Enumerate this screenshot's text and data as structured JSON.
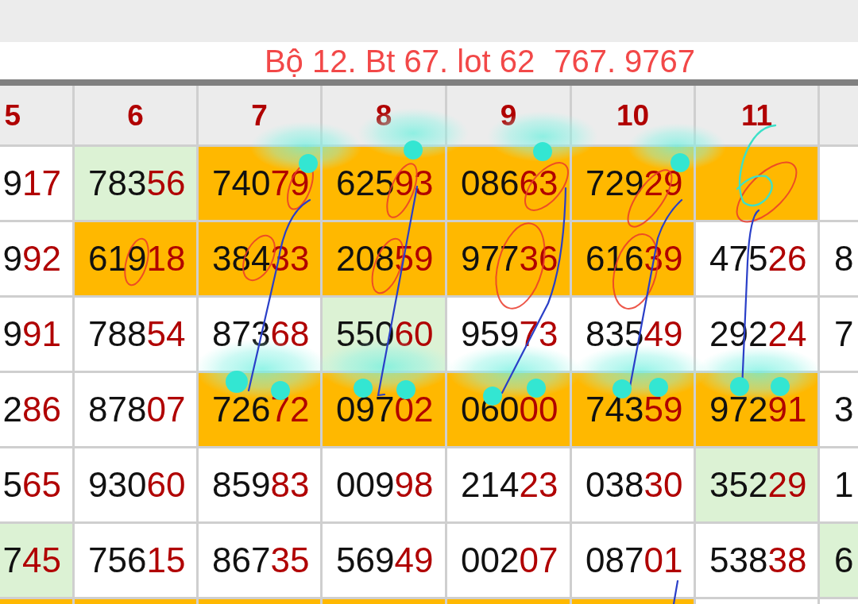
{
  "table": {
    "columns": [
      "5",
      "6",
      "7",
      "8",
      "9",
      "10",
      "11"
    ],
    "rows": [
      {
        "cells": [
          {
            "head": "9",
            "tail": "17",
            "color": "#ffffff"
          },
          {
            "head": "783",
            "tail": "56",
            "color": "#dcf2d4"
          },
          {
            "head": "740",
            "tail": "79",
            "color": "#ffb800"
          },
          {
            "head": "625",
            "tail": "93",
            "color": "#ffb800"
          },
          {
            "head": "086",
            "tail": "63",
            "color": "#ffb800"
          },
          {
            "head": "729",
            "tail": "29",
            "color": "#ffb800"
          },
          {
            "color": "#ffb800"
          },
          {
            "color": "#ffffff"
          }
        ]
      },
      {
        "cells": [
          {
            "head": "9",
            "tail": "92",
            "color": "#ffffff"
          },
          {
            "head": "619",
            "tail": "18",
            "color": "#ffb800"
          },
          {
            "head": "384",
            "tail": "33",
            "color": "#ffb800"
          },
          {
            "head": "208",
            "tail": "59",
            "color": "#ffb800"
          },
          {
            "head": "977",
            "tail": "36",
            "color": "#ffb800"
          },
          {
            "head": "616",
            "tail": "39",
            "color": "#ffb800"
          },
          {
            "head": "475",
            "tail": "26",
            "color": "#ffffff"
          },
          {
            "head": "8",
            "color": "#ffffff"
          }
        ]
      },
      {
        "cells": [
          {
            "head": "9",
            "tail": "91",
            "color": "#ffffff"
          },
          {
            "head": "788",
            "tail": "54",
            "color": "#ffffff"
          },
          {
            "head": "873",
            "tail": "68",
            "color": "#ffffff"
          },
          {
            "head": "550",
            "tail": "60",
            "color": "#dcf2d4"
          },
          {
            "head": "959",
            "tail": "73",
            "color": "#ffffff"
          },
          {
            "head": "835",
            "tail": "49",
            "color": "#ffffff"
          },
          {
            "head": "292",
            "tail": "24",
            "color": "#ffffff"
          },
          {
            "head": "7",
            "color": "#ffffff"
          }
        ]
      },
      {
        "cells": [
          {
            "head": "2",
            "tail": "86",
            "color": "#ffffff"
          },
          {
            "head": "878",
            "tail": "07",
            "color": "#ffffff"
          },
          {
            "head": "726",
            "tail": "72",
            "color": "#ffb800"
          },
          {
            "head": "097",
            "tail": "02",
            "color": "#ffb800"
          },
          {
            "head": "060",
            "tail": "00",
            "color": "#ffb800"
          },
          {
            "head": "743",
            "tail": "59",
            "color": "#ffb800"
          },
          {
            "head": "972",
            "tail": "91",
            "color": "#ffb800"
          },
          {
            "head": "3",
            "color": "#ffffff"
          }
        ]
      },
      {
        "cells": [
          {
            "head": "5",
            "tail": "65",
            "color": "#ffffff"
          },
          {
            "head": "930",
            "tail": "60",
            "color": "#ffffff"
          },
          {
            "head": "859",
            "tail": "83",
            "color": "#ffffff"
          },
          {
            "head": "009",
            "tail": "98",
            "color": "#ffffff"
          },
          {
            "head": "214",
            "tail": "23",
            "color": "#ffffff"
          },
          {
            "head": "038",
            "tail": "30",
            "color": "#ffffff"
          },
          {
            "head": "352",
            "tail": "29",
            "color": "#dcf2d4"
          },
          {
            "head": "1",
            "color": "#ffffff"
          }
        ]
      },
      {
        "cells": [
          {
            "head": "7",
            "tail": "45",
            "color": "#dcf2d4"
          },
          {
            "head": "756",
            "tail": "15",
            "color": "#ffffff"
          },
          {
            "head": "867",
            "tail": "35",
            "color": "#ffffff"
          },
          {
            "head": "569",
            "tail": "49",
            "color": "#ffffff"
          },
          {
            "head": "002",
            "tail": "07",
            "color": "#ffffff"
          },
          {
            "head": "087",
            "tail": "01",
            "color": "#ffffff"
          },
          {
            "head": "538",
            "tail": "38",
            "color": "#ffffff"
          },
          {
            "head": "6",
            "color": "#dcf2d4"
          }
        ]
      },
      {
        "cells": [
          {
            "color": "#ffb800"
          },
          {
            "color": "#ffb800"
          },
          {
            "color": "#ffb800"
          },
          {
            "color": "#ffb800"
          },
          {
            "color": "#ffb800"
          },
          {
            "color": "#ffb800"
          },
          {
            "color": "#ffffff"
          },
          {
            "color": "#ffffff"
          }
        ]
      }
    ]
  },
  "annotation": {
    "lines": [
      "Bộ 12. Bt 67. lot 62",
      "767. 9767"
    ]
  }
}
